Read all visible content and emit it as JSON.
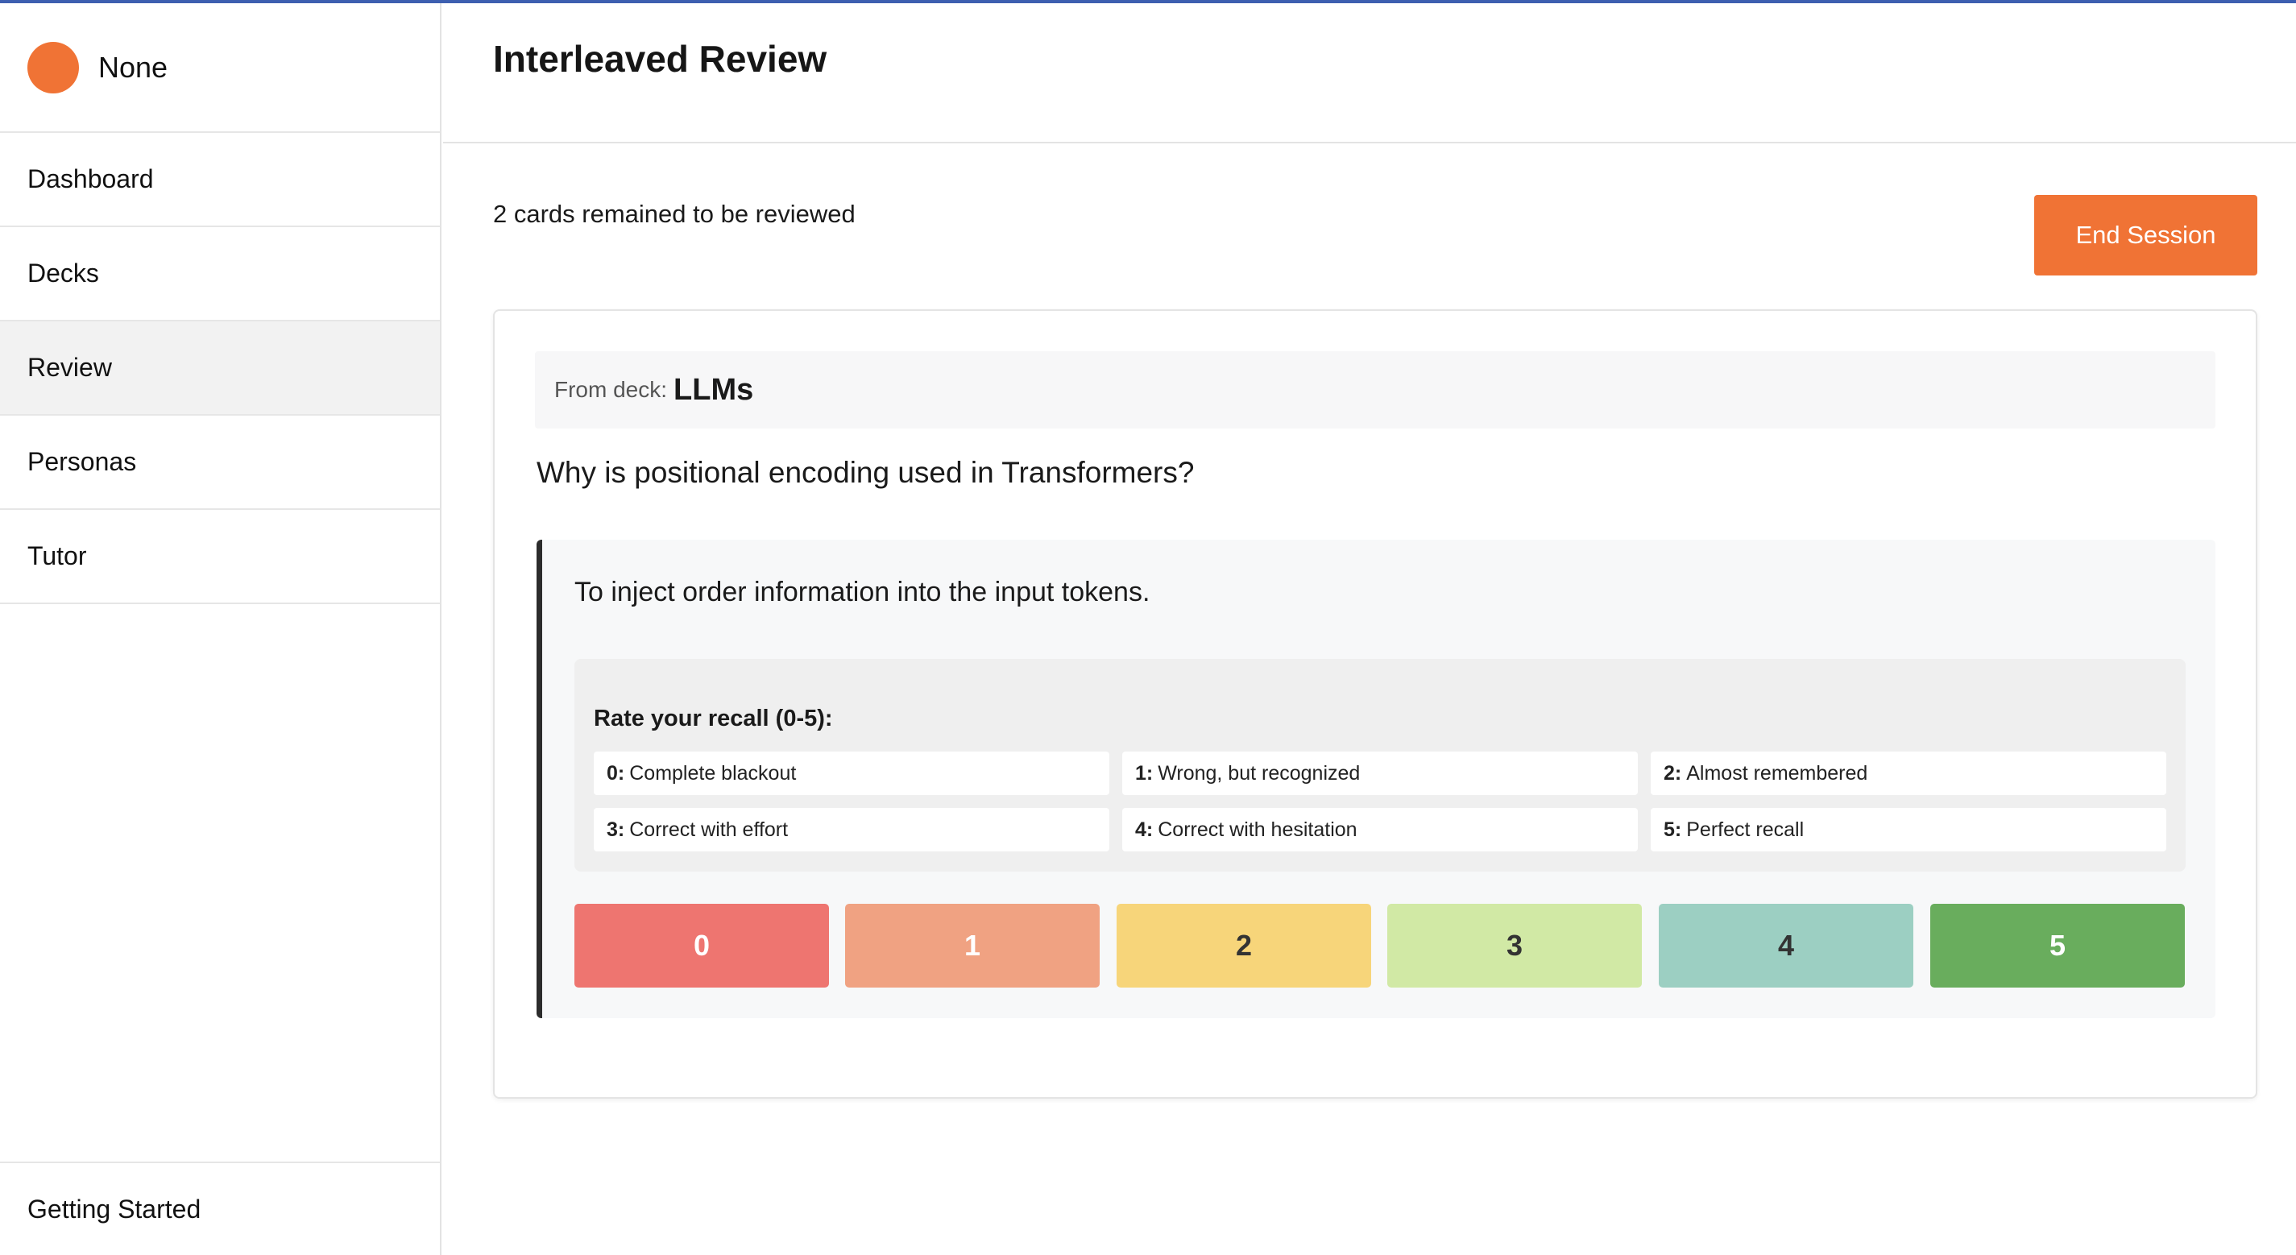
{
  "sidebar": {
    "user_name": "None",
    "items": [
      {
        "label": "Dashboard"
      },
      {
        "label": "Decks"
      },
      {
        "label": "Review"
      },
      {
        "label": "Personas"
      },
      {
        "label": "Tutor"
      }
    ],
    "active_item": "Review",
    "footer": "Getting Started"
  },
  "header": {
    "title": "Interleaved Review"
  },
  "session": {
    "status": "2 cards remained to be reviewed",
    "end_label": "End Session"
  },
  "card": {
    "deck_label": "From deck:",
    "deck_name": "LLMs",
    "question": "Why is positional encoding used in Transformers?",
    "answer": "To inject order information into the input tokens."
  },
  "rating": {
    "title": "Rate your recall (0-5):",
    "legend": [
      {
        "key": "0:",
        "text": "Complete blackout"
      },
      {
        "key": "1:",
        "text": "Wrong, but recognized"
      },
      {
        "key": "2:",
        "text": "Almost remembered"
      },
      {
        "key": "3:",
        "text": "Correct with effort"
      },
      {
        "key": "4:",
        "text": "Correct with hesitation"
      },
      {
        "key": "5:",
        "text": "Perfect recall"
      }
    ],
    "buttons": [
      {
        "label": "0",
        "color": "#ee7570",
        "text_color": "#ffffff"
      },
      {
        "label": "1",
        "color": "#f0a282",
        "text_color": "#ffffff"
      },
      {
        "label": "2",
        "color": "#f7d57a",
        "text_color": "#333333"
      },
      {
        "label": "3",
        "color": "#d1e9a5",
        "text_color": "#333333"
      },
      {
        "label": "4",
        "color": "#9ccfc2",
        "text_color": "#333333"
      },
      {
        "label": "5",
        "color": "#69ad5d",
        "text_color": "#ffffff"
      }
    ]
  },
  "colors": {
    "accent": "#f07335",
    "top_line": "#3d5fb0"
  }
}
